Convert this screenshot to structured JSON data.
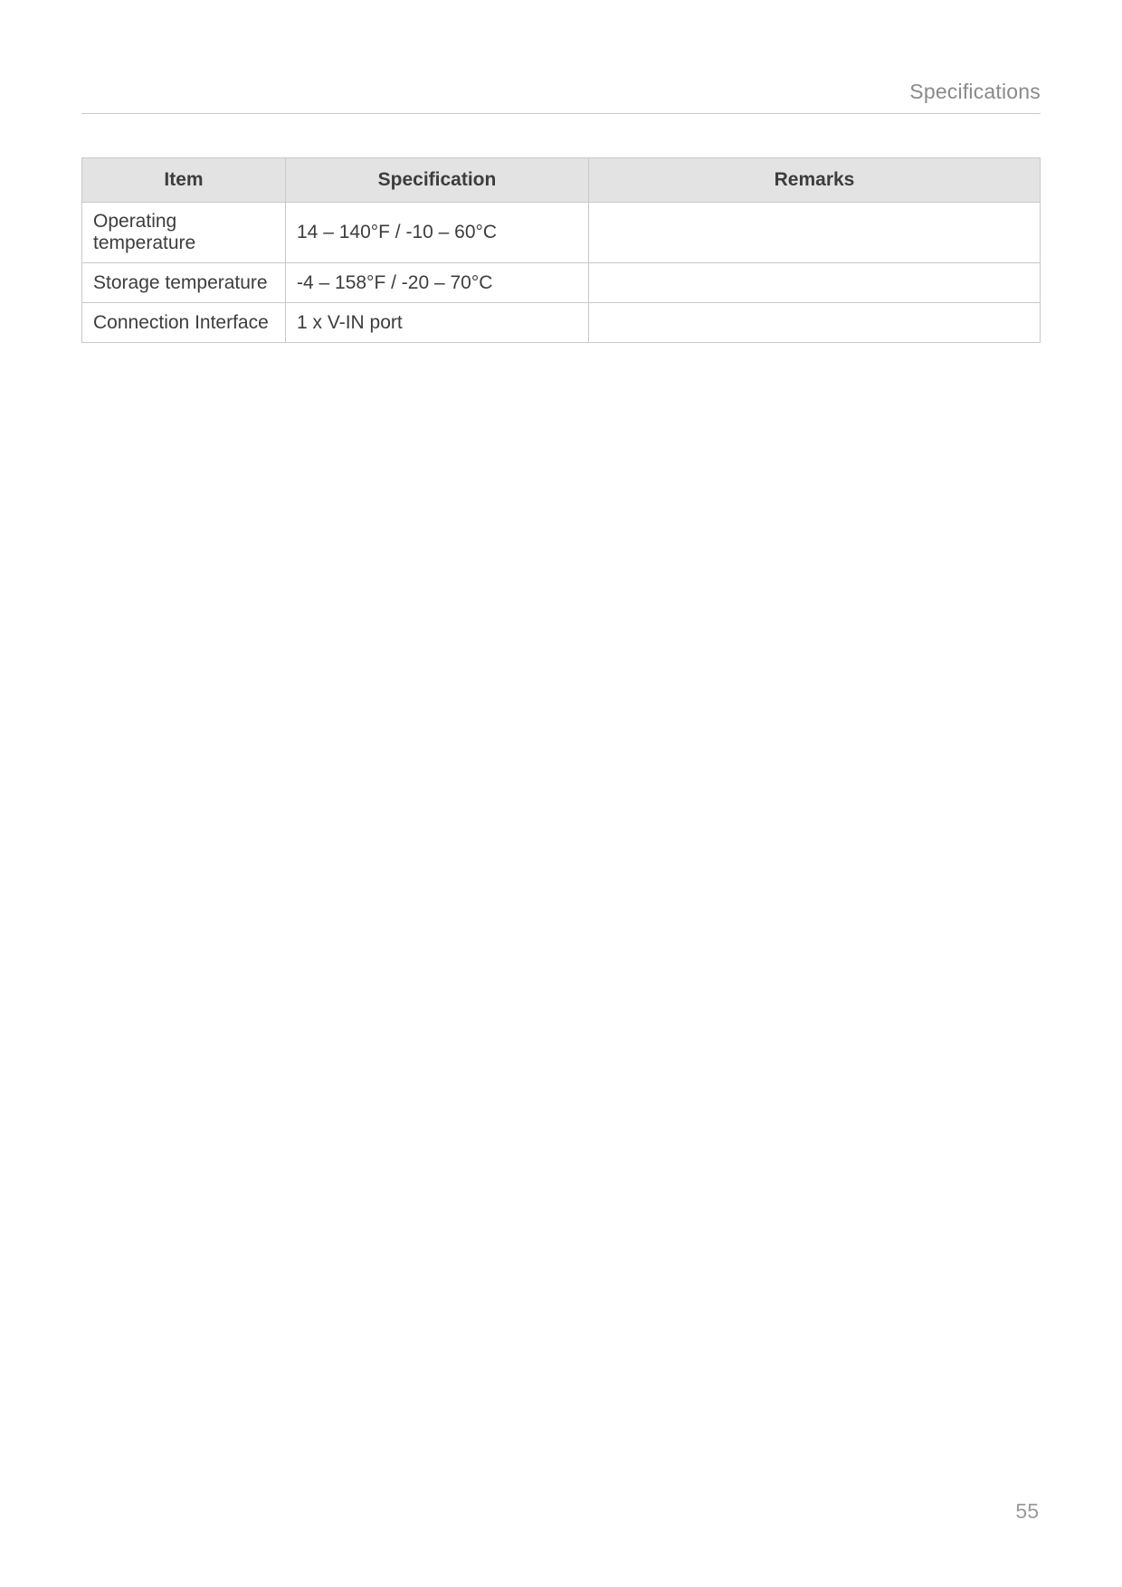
{
  "header": {
    "title": "Specifications"
  },
  "table": {
    "headers": {
      "item": "Item",
      "spec": "Specification",
      "remarks": "Remarks"
    },
    "rows": [
      {
        "item": "Operating temperature",
        "spec": "14 – 140°F / -10 – 60°C",
        "remarks": ""
      },
      {
        "item": "Storage temperature",
        "spec": "-4 – 158°F / -20 – 70°C",
        "remarks": ""
      },
      {
        "item": "Connection Interface",
        "spec": "1 x V-IN port",
        "remarks": ""
      }
    ]
  },
  "footer": {
    "page_number": "55"
  }
}
